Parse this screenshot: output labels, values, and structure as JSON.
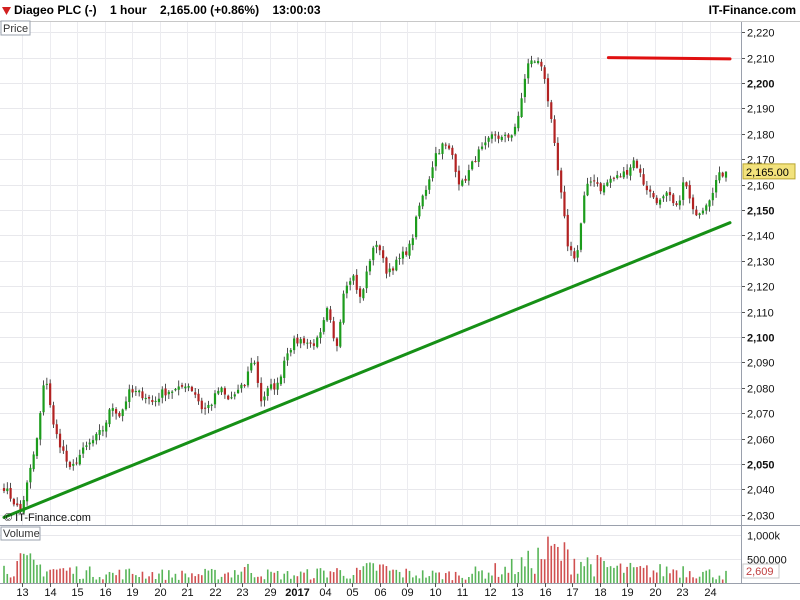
{
  "header": {
    "instrument": "Diageo PLC (-)",
    "timeframe": "1 hour",
    "price": "2,165.00 (+0.86%)",
    "time": "13:00:03",
    "brand": "IT-Finance.com",
    "change_icon": "arrow-down-icon"
  },
  "panels": {
    "price_label": "Price",
    "volume_label": "Volume",
    "watermark": "© IT-Finance.com"
  },
  "colors": {
    "bull": "#1c9c1c",
    "bear": "#b22222",
    "trendline_support": "#169016",
    "trendline_resistance": "#e01010",
    "last_price_box": "#f2e27c"
  },
  "chart_data": [
    {
      "type": "candlestick",
      "title": "Diageo PLC (-)",
      "interval": "1 hour",
      "xlabel": "",
      "ylabel": "Price",
      "ylim": [
        2026,
        2224
      ],
      "yticks": [
        2030,
        2040,
        2050,
        2060,
        2070,
        2080,
        2090,
        2100,
        2110,
        2120,
        2130,
        2140,
        2150,
        2160,
        2170,
        2180,
        2190,
        2200,
        2210,
        2220
      ],
      "ytick_labels": [
        "2,030",
        "2,040",
        "2,050",
        "2,060",
        "2,070",
        "2,080",
        "2,090",
        "2,100",
        "2,110",
        "2,120",
        "2,130",
        "2,140",
        "2,150",
        "2,160",
        "2,170",
        "2,180",
        "2,190",
        "2,200",
        "2,210",
        "2,220"
      ],
      "x_tick_labels": [
        "13",
        "14",
        "15",
        "16",
        "19",
        "20",
        "21",
        "22",
        "23",
        "29",
        "2017",
        "04",
        "05",
        "06",
        "09",
        "10",
        "11",
        "12",
        "13",
        "16",
        "17",
        "18",
        "19",
        "20",
        "23",
        "24"
      ],
      "x_tick_bold": [
        false,
        false,
        false,
        false,
        false,
        false,
        false,
        false,
        false,
        false,
        true,
        false,
        false,
        false,
        false,
        false,
        false,
        false,
        false,
        false,
        false,
        false,
        false,
        false,
        false,
        false
      ],
      "grid": true,
      "last_price": 2165.0,
      "last_price_label": "2,165.00",
      "path": [
        2041,
        2036,
        2031,
        2045,
        2060,
        2086,
        2064,
        2056,
        2047,
        2053,
        2057,
        2060,
        2064,
        2073,
        2069,
        2078,
        2078,
        2077,
        2074,
        2078,
        2079,
        2079,
        2082,
        2078,
        2071,
        2074,
        2080,
        2075,
        2078,
        2081,
        2093,
        2075,
        2080,
        2081,
        2094,
        2098,
        2099,
        2097,
        2099,
        2111,
        2094,
        2120,
        2125,
        2114,
        2130,
        2138,
        2126,
        2128,
        2132,
        2136,
        2151,
        2160,
        2172,
        2176,
        2172,
        2159,
        2165,
        2172,
        2175,
        2180,
        2178,
        2179,
        2186,
        2207,
        2209,
        2206,
        2183,
        2159,
        2135,
        2131,
        2157,
        2163,
        2158,
        2162,
        2163,
        2165,
        2170,
        2161,
        2156,
        2153,
        2156,
        2150,
        2162,
        2149,
        2150,
        2155,
        2163,
        2165
      ],
      "trendlines": [
        {
          "name": "support",
          "color": "#169016",
          "points": [
            [
              0,
              2029
            ],
            [
              1,
              2145
            ]
          ]
        },
        {
          "name": "resistance",
          "color": "#e01010",
          "points": [
            [
              0.8325,
              2210
            ],
            [
              1,
              2209.5
            ]
          ]
        }
      ]
    },
    {
      "type": "bar",
      "title": "Volume",
      "ylim": [
        0,
        1150000
      ],
      "yticks": [
        500000,
        1000000
      ],
      "ytick_labels": [
        "500,000",
        "1,000k"
      ],
      "last_value_label": "2,609",
      "activity_path": [
        0.35,
        0.5,
        0.35,
        0.3,
        0.25,
        0.22,
        0.25,
        0.22,
        0.2,
        0.22,
        0.22,
        0.35,
        0.22,
        0.2,
        0.22,
        0.3,
        0.22,
        0.4,
        0.25,
        0.22,
        0.2,
        0.22,
        0.28,
        0.35,
        0.5,
        0.8,
        0.6,
        0.45,
        0.35,
        0.3,
        0.3,
        0.35,
        0.25,
        0.2
      ]
    }
  ]
}
